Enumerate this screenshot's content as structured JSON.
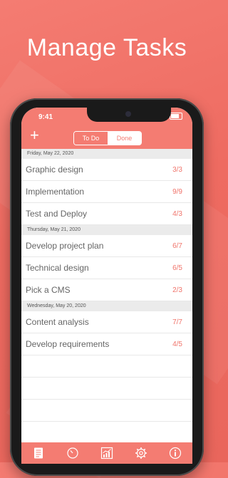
{
  "headline": "Manage Tasks",
  "status": {
    "time": "9:41"
  },
  "segment": {
    "todo_label": "To Do",
    "done_label": "Done",
    "selected": "Done"
  },
  "colors": {
    "accent": "#f47c72",
    "count": "#f0756c",
    "header_bg": "#ebebeb"
  },
  "sections": [
    {
      "date": "Friday, May 22, 2020",
      "tasks": [
        {
          "title": "Graphic design",
          "count": "3/3"
        },
        {
          "title": "Implementation",
          "count": "9/9"
        },
        {
          "title": "Test and Deploy",
          "count": "4/3"
        }
      ]
    },
    {
      "date": "Thursday, May 21, 2020",
      "tasks": [
        {
          "title": "Develop project plan",
          "count": "6/7"
        },
        {
          "title": "Technical design",
          "count": "6/5"
        },
        {
          "title": "Pick a CMS",
          "count": "2/3"
        }
      ]
    },
    {
      "date": "Wednesday, May 20, 2020",
      "tasks": [
        {
          "title": "Content analysis",
          "count": "7/7"
        },
        {
          "title": "Develop requirements",
          "count": "4/5"
        }
      ]
    }
  ],
  "tabbar": {
    "tabs": [
      {
        "icon": "list-icon",
        "selected": true
      },
      {
        "icon": "timer-icon",
        "selected": false
      },
      {
        "icon": "chart-icon",
        "selected": false
      },
      {
        "icon": "gear-icon",
        "selected": false
      },
      {
        "icon": "info-icon",
        "selected": false
      }
    ]
  }
}
